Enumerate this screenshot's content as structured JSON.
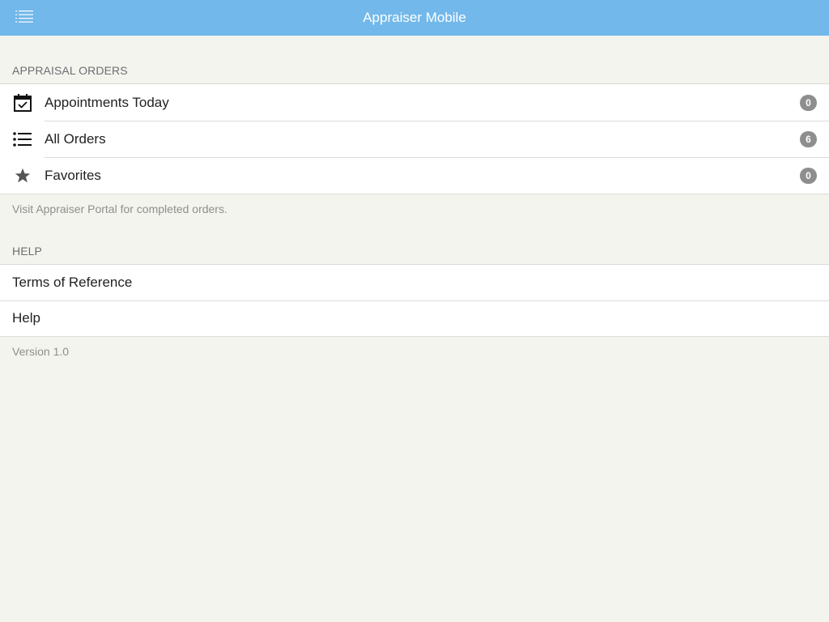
{
  "navbar": {
    "title": "Appraiser Mobile",
    "menu_icon": "list-menu-icon"
  },
  "orders_section": {
    "header": "APPRAISAL ORDERS",
    "items": [
      {
        "label": "Appointments Today",
        "icon": "calendar-check-icon",
        "badge": "0"
      },
      {
        "label": "All Orders",
        "icon": "bulleted-list-icon",
        "badge": "6"
      },
      {
        "label": "Favorites",
        "icon": "star-icon",
        "badge": "0"
      }
    ],
    "footnote": "Visit Appraiser Portal for completed orders."
  },
  "help_section": {
    "header": "HELP",
    "items": [
      {
        "label": "Terms of Reference"
      },
      {
        "label": "Help"
      }
    ],
    "footnote": "Version 1.0"
  },
  "colors": {
    "navbar": "#72b8ea",
    "background": "#f4f4ee",
    "badge": "#8e8e8e"
  }
}
